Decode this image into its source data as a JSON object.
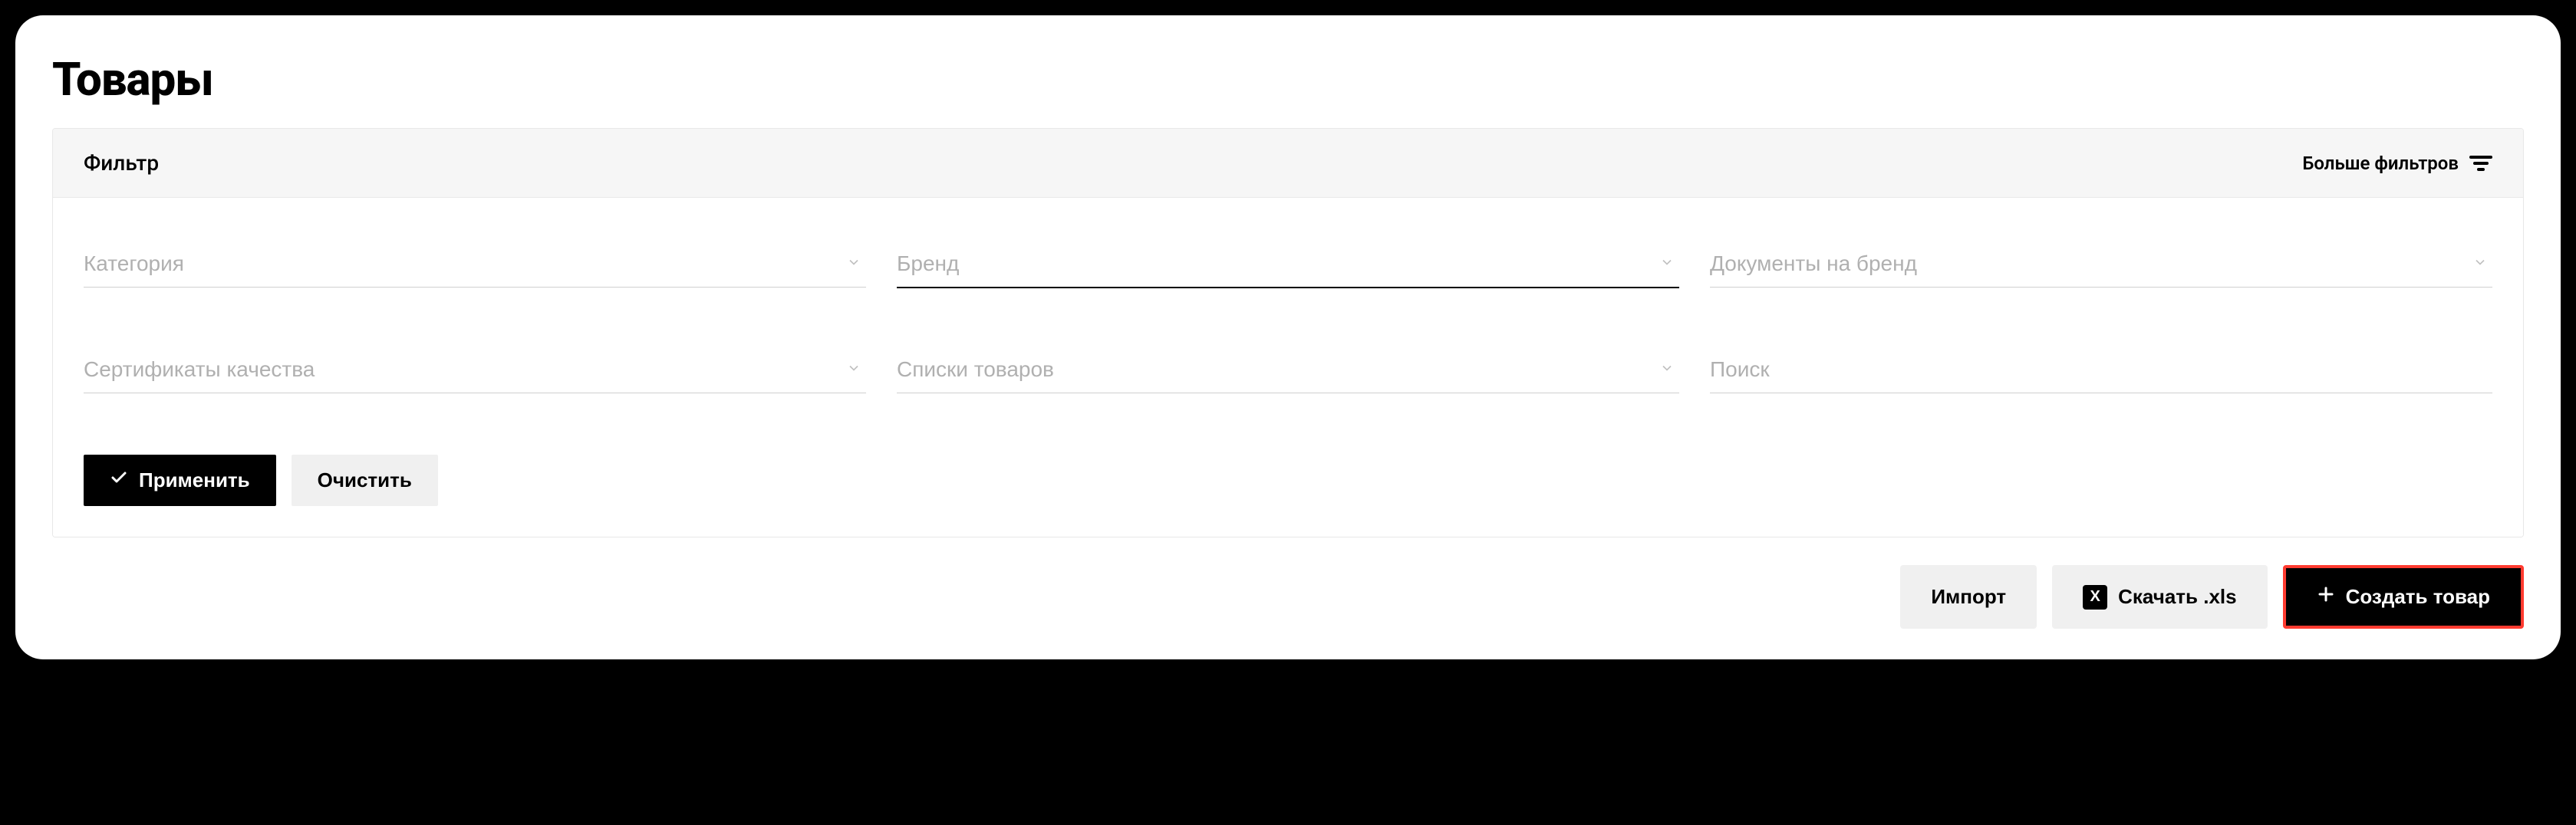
{
  "page": {
    "title": "Товары"
  },
  "filter": {
    "header_label": "Фильтр",
    "more_filters_label": "Больше фильтров",
    "fields": {
      "category": {
        "placeholder": "Категория"
      },
      "brand": {
        "placeholder": "Бренд"
      },
      "brand_docs": {
        "placeholder": "Документы на бренд"
      },
      "quality_certs": {
        "placeholder": "Сертификаты качества"
      },
      "product_lists": {
        "placeholder": "Списки товаров"
      },
      "search": {
        "placeholder": "Поиск"
      }
    },
    "apply_label": "Применить",
    "clear_label": "Очистить"
  },
  "actions": {
    "import_label": "Импорт",
    "download_xls_label": "Скачать .xls",
    "xls_badge": "X",
    "create_product_label": "Создать товар"
  }
}
